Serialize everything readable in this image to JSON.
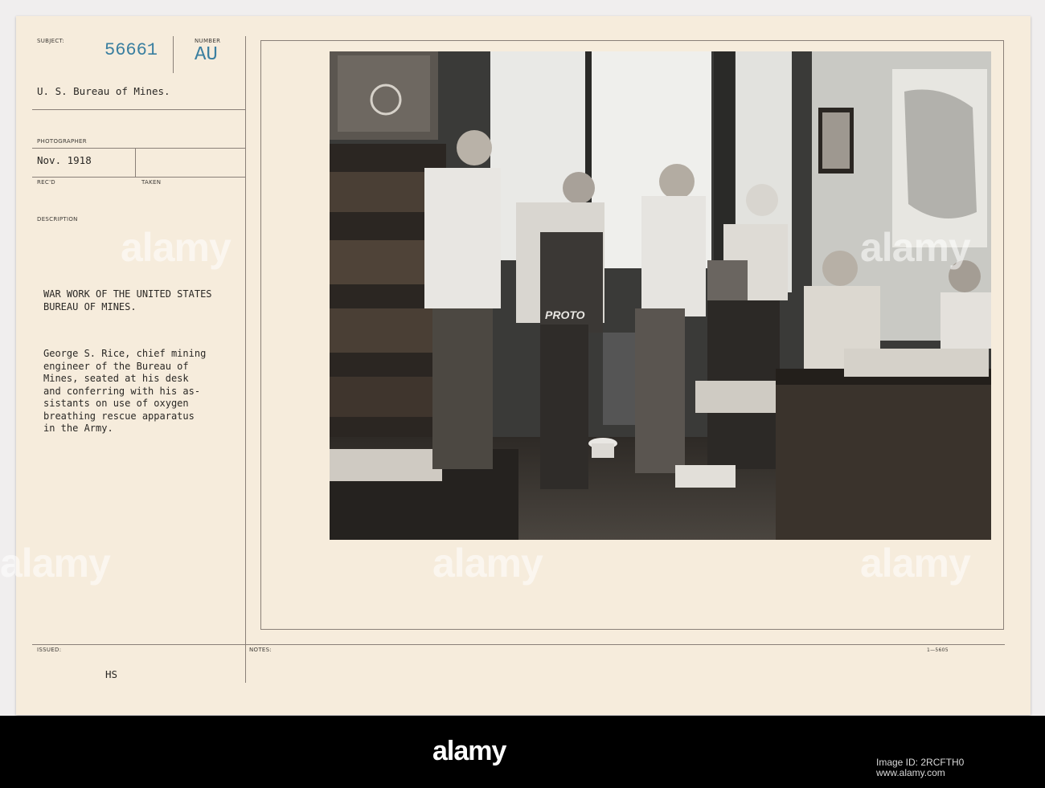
{
  "card": {
    "subject_label": "SUBJECT:",
    "subject_number": "56661",
    "number_label": "NUMBER",
    "number_stamp": "AU",
    "subject_text": "U. S. Bureau of Mines.",
    "photographer_label": "PHOTOGRAPHER",
    "recd_date": "Nov. 1918",
    "recd_label": "REC'D",
    "taken_label": "TAKEN",
    "description_label": "DESCRIPTION",
    "description_title_1": "WAR WORK OF THE UNITED STATES",
    "description_title_2": "BUREAU OF MINES.",
    "description_body": [
      "George S. Rice, chief mining",
      "engineer of the Bureau of",
      "Mines, seated at his desk",
      "and conferring with his as-",
      "sistants on use of oxygen",
      "breathing rescue apparatus",
      "in the Army."
    ],
    "issued_label": "ISSUED:",
    "issued_value": "HS",
    "notes_label": "NOTES:",
    "form_number": "1—5605"
  },
  "photo": {
    "apparatus_label": "PROTO"
  },
  "watermark": {
    "text": "alamy"
  },
  "footer": {
    "brand": "alamy",
    "image_id": "Image ID: 2RCFTH0",
    "site": "www.alamy.com"
  }
}
